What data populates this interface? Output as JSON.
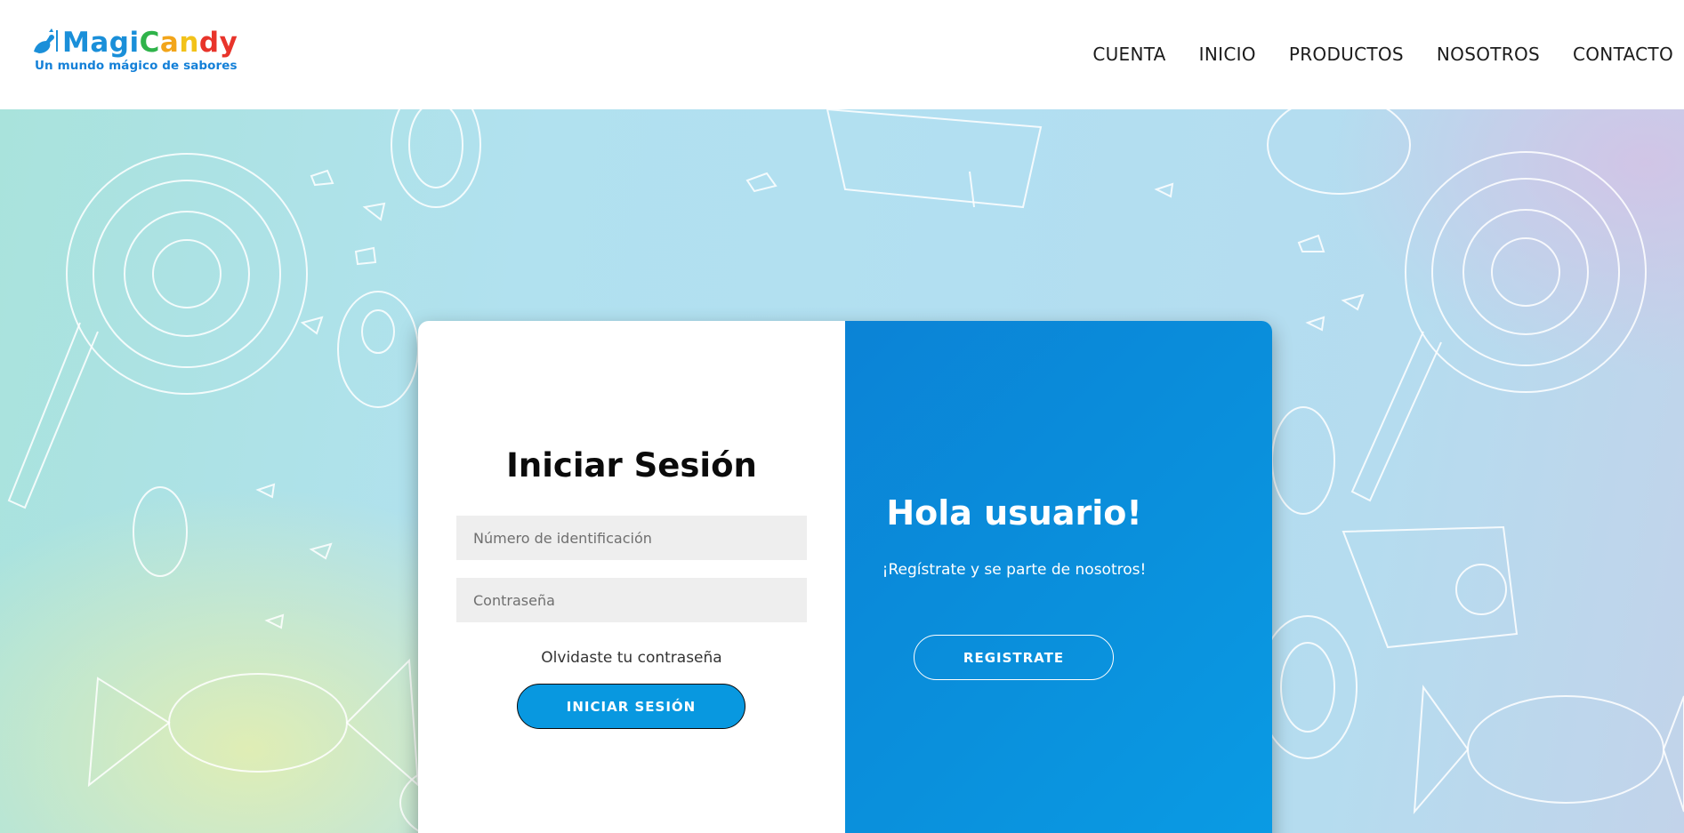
{
  "brand": {
    "letters": [
      {
        "ch": "M",
        "color": "#1a8fd9"
      },
      {
        "ch": "a",
        "color": "#1a8fd9"
      },
      {
        "ch": "g",
        "color": "#1a8fd9"
      },
      {
        "ch": "i",
        "color": "#1a8fd9"
      },
      {
        "ch": "C",
        "color": "#2fb34a"
      },
      {
        "ch": "a",
        "color": "#f2a51a"
      },
      {
        "ch": "n",
        "color": "#f2c21a"
      },
      {
        "ch": "d",
        "color": "#e8342b"
      },
      {
        "ch": "y",
        "color": "#e8342b"
      }
    ],
    "tagline": "Un mundo mágico de sabores"
  },
  "nav": {
    "items": [
      "CUENTA",
      "INICIO",
      "PRODUCTOS",
      "NOSOTROS",
      "CONTACTO"
    ]
  },
  "login": {
    "title": "Iniciar Sesión",
    "id_placeholder": "Número de identificación",
    "password_placeholder": "Contraseña",
    "forgot": "Olvidaste tu contraseña",
    "button": "INICIAR SESIÓN"
  },
  "register": {
    "title": "Hola usuario!",
    "subtitle": "¡Regístrate y se parte de nosotros!",
    "button": "REGISTRATE"
  },
  "colors": {
    "accent_blue": "#0898e0",
    "panel_blue": "#0a90dc",
    "field_bg": "#eeeeee"
  }
}
